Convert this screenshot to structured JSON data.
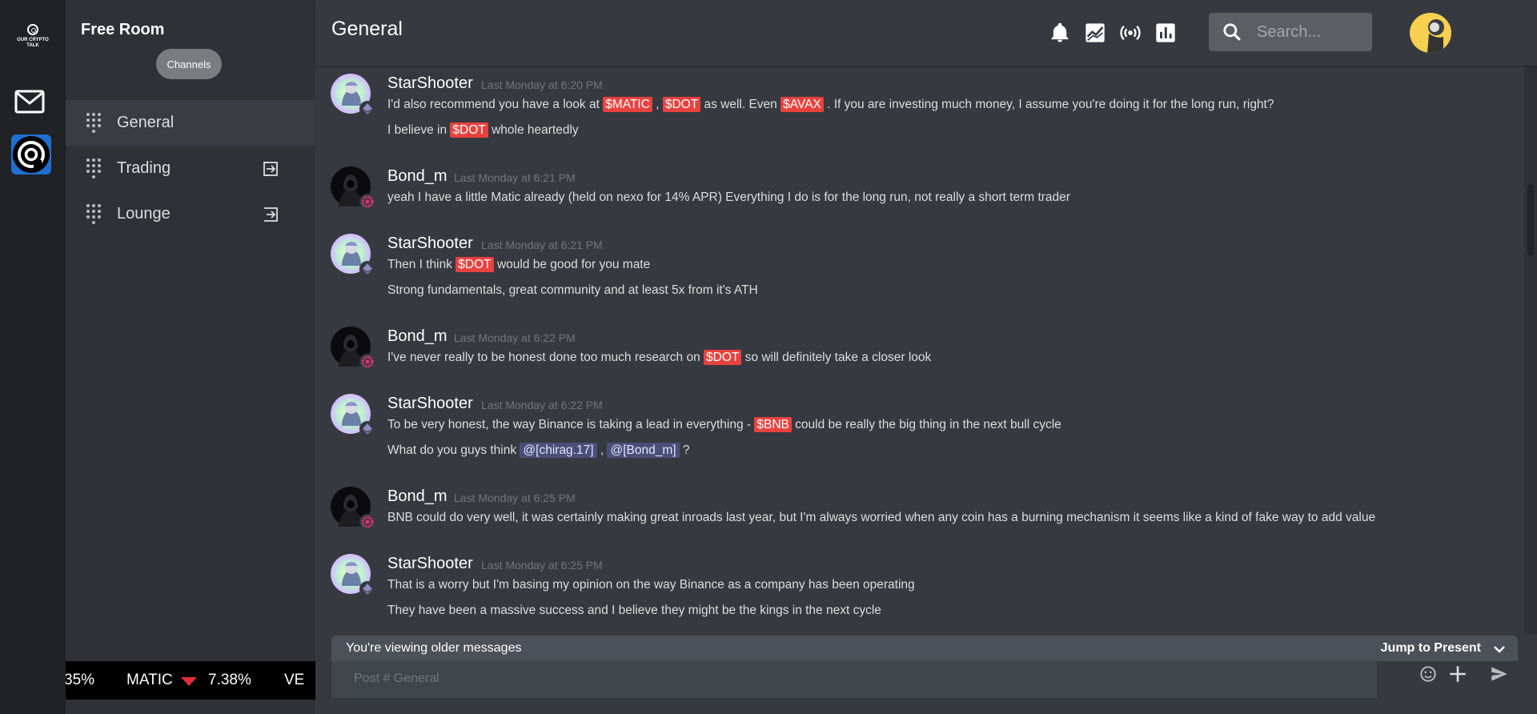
{
  "rail": {
    "logo_text": "OUR CRYPTO TALK"
  },
  "sidebar": {
    "room_title": "Free Room",
    "channels_label": "Channels",
    "channels": [
      {
        "name": "General",
        "active": true
      },
      {
        "name": "Trading",
        "active": false
      },
      {
        "name": "Lounge",
        "active": false
      }
    ],
    "ticker": {
      "prev_change": "35%",
      "symbol": "MATIC",
      "direction": "down",
      "change": "7.38%",
      "next_symbol": "VE"
    }
  },
  "header": {
    "title": "General",
    "icons": [
      "bell-icon",
      "chart-line-icon",
      "broadcast-icon",
      "bar-chart-icon"
    ],
    "search_placeholder": "Search..."
  },
  "messages": [
    {
      "author": "StarShooter",
      "time": "Last Monday at 6:20 PM",
      "lines": [
        [
          {
            "t": "I'd also recommend you have a look at "
          },
          {
            "tag": "$MATIC"
          },
          {
            "t": " , "
          },
          {
            "tag": "$DOT"
          },
          {
            "t": " as well. Even "
          },
          {
            "tag": "$AVAX"
          },
          {
            "t": " . If you are investing much money, I assume you're doing it for the long run, right?"
          }
        ],
        [
          {
            "t": "I believe in "
          },
          {
            "tag": "$DOT"
          },
          {
            "t": " whole heartedly"
          }
        ]
      ]
    },
    {
      "author": "Bond_m",
      "time": "Last Monday at 6:21 PM",
      "lines": [
        [
          {
            "t": "yeah I have a little Matic already (held on nexo for 14% APR)  Everything I do is for the long run, not really a short term trader"
          }
        ]
      ]
    },
    {
      "author": "StarShooter",
      "time": "Last Monday at 6:21 PM",
      "lines": [
        [
          {
            "t": "Then I think "
          },
          {
            "tag": "$DOT"
          },
          {
            "t": " would be good for you mate"
          }
        ],
        [
          {
            "t": "Strong fundamentals, great community and at least 5x from it's ATH"
          }
        ]
      ]
    },
    {
      "author": "Bond_m",
      "time": "Last Monday at 6:22 PM",
      "lines": [
        [
          {
            "t": "I've never really to be honest done too much research on "
          },
          {
            "tag": "$DOT"
          },
          {
            "t": "  so will definitely take a closer look"
          }
        ]
      ]
    },
    {
      "author": "StarShooter",
      "time": "Last Monday at 6:22 PM",
      "lines": [
        [
          {
            "t": "To be very honest, the way Binance is taking a lead in everything - "
          },
          {
            "tag": "$BNB"
          },
          {
            "t": " could be really the big thing in the next bull cycle"
          }
        ],
        [
          {
            "t": "What do you guys think "
          },
          {
            "mention": "@[chirag.17]"
          },
          {
            "t": "  , "
          },
          {
            "mention": "@[Bond_m]"
          },
          {
            "t": "  ?"
          }
        ]
      ]
    },
    {
      "author": "Bond_m",
      "time": "Last Monday at 6:25 PM",
      "lines": [
        [
          {
            "t": "BNB could do very well, it was certainly making great inroads last year, but I'm always worried when any coin has a burning mechanism it seems like a kind of fake way to add value"
          }
        ]
      ]
    },
    {
      "author": "StarShooter",
      "time": "Last Monday at 6:25 PM",
      "lines": [
        [
          {
            "t": "That is a worry but I'm basing my opinion on the way Binance as a company has been operating"
          }
        ],
        [
          {
            "t": "They have been a massive success and I believe they might be the kings in the next cycle"
          }
        ]
      ]
    }
  ],
  "older_bar": {
    "text": "You're viewing older messages",
    "jump_label": "Jump to Present"
  },
  "composer": {
    "placeholder": "Post # General"
  },
  "colors": {
    "tag": "#e8423f",
    "mention": "#4a4f7a",
    "background": "#36393f",
    "sidebar": "#2f3136",
    "rail": "#202225"
  }
}
